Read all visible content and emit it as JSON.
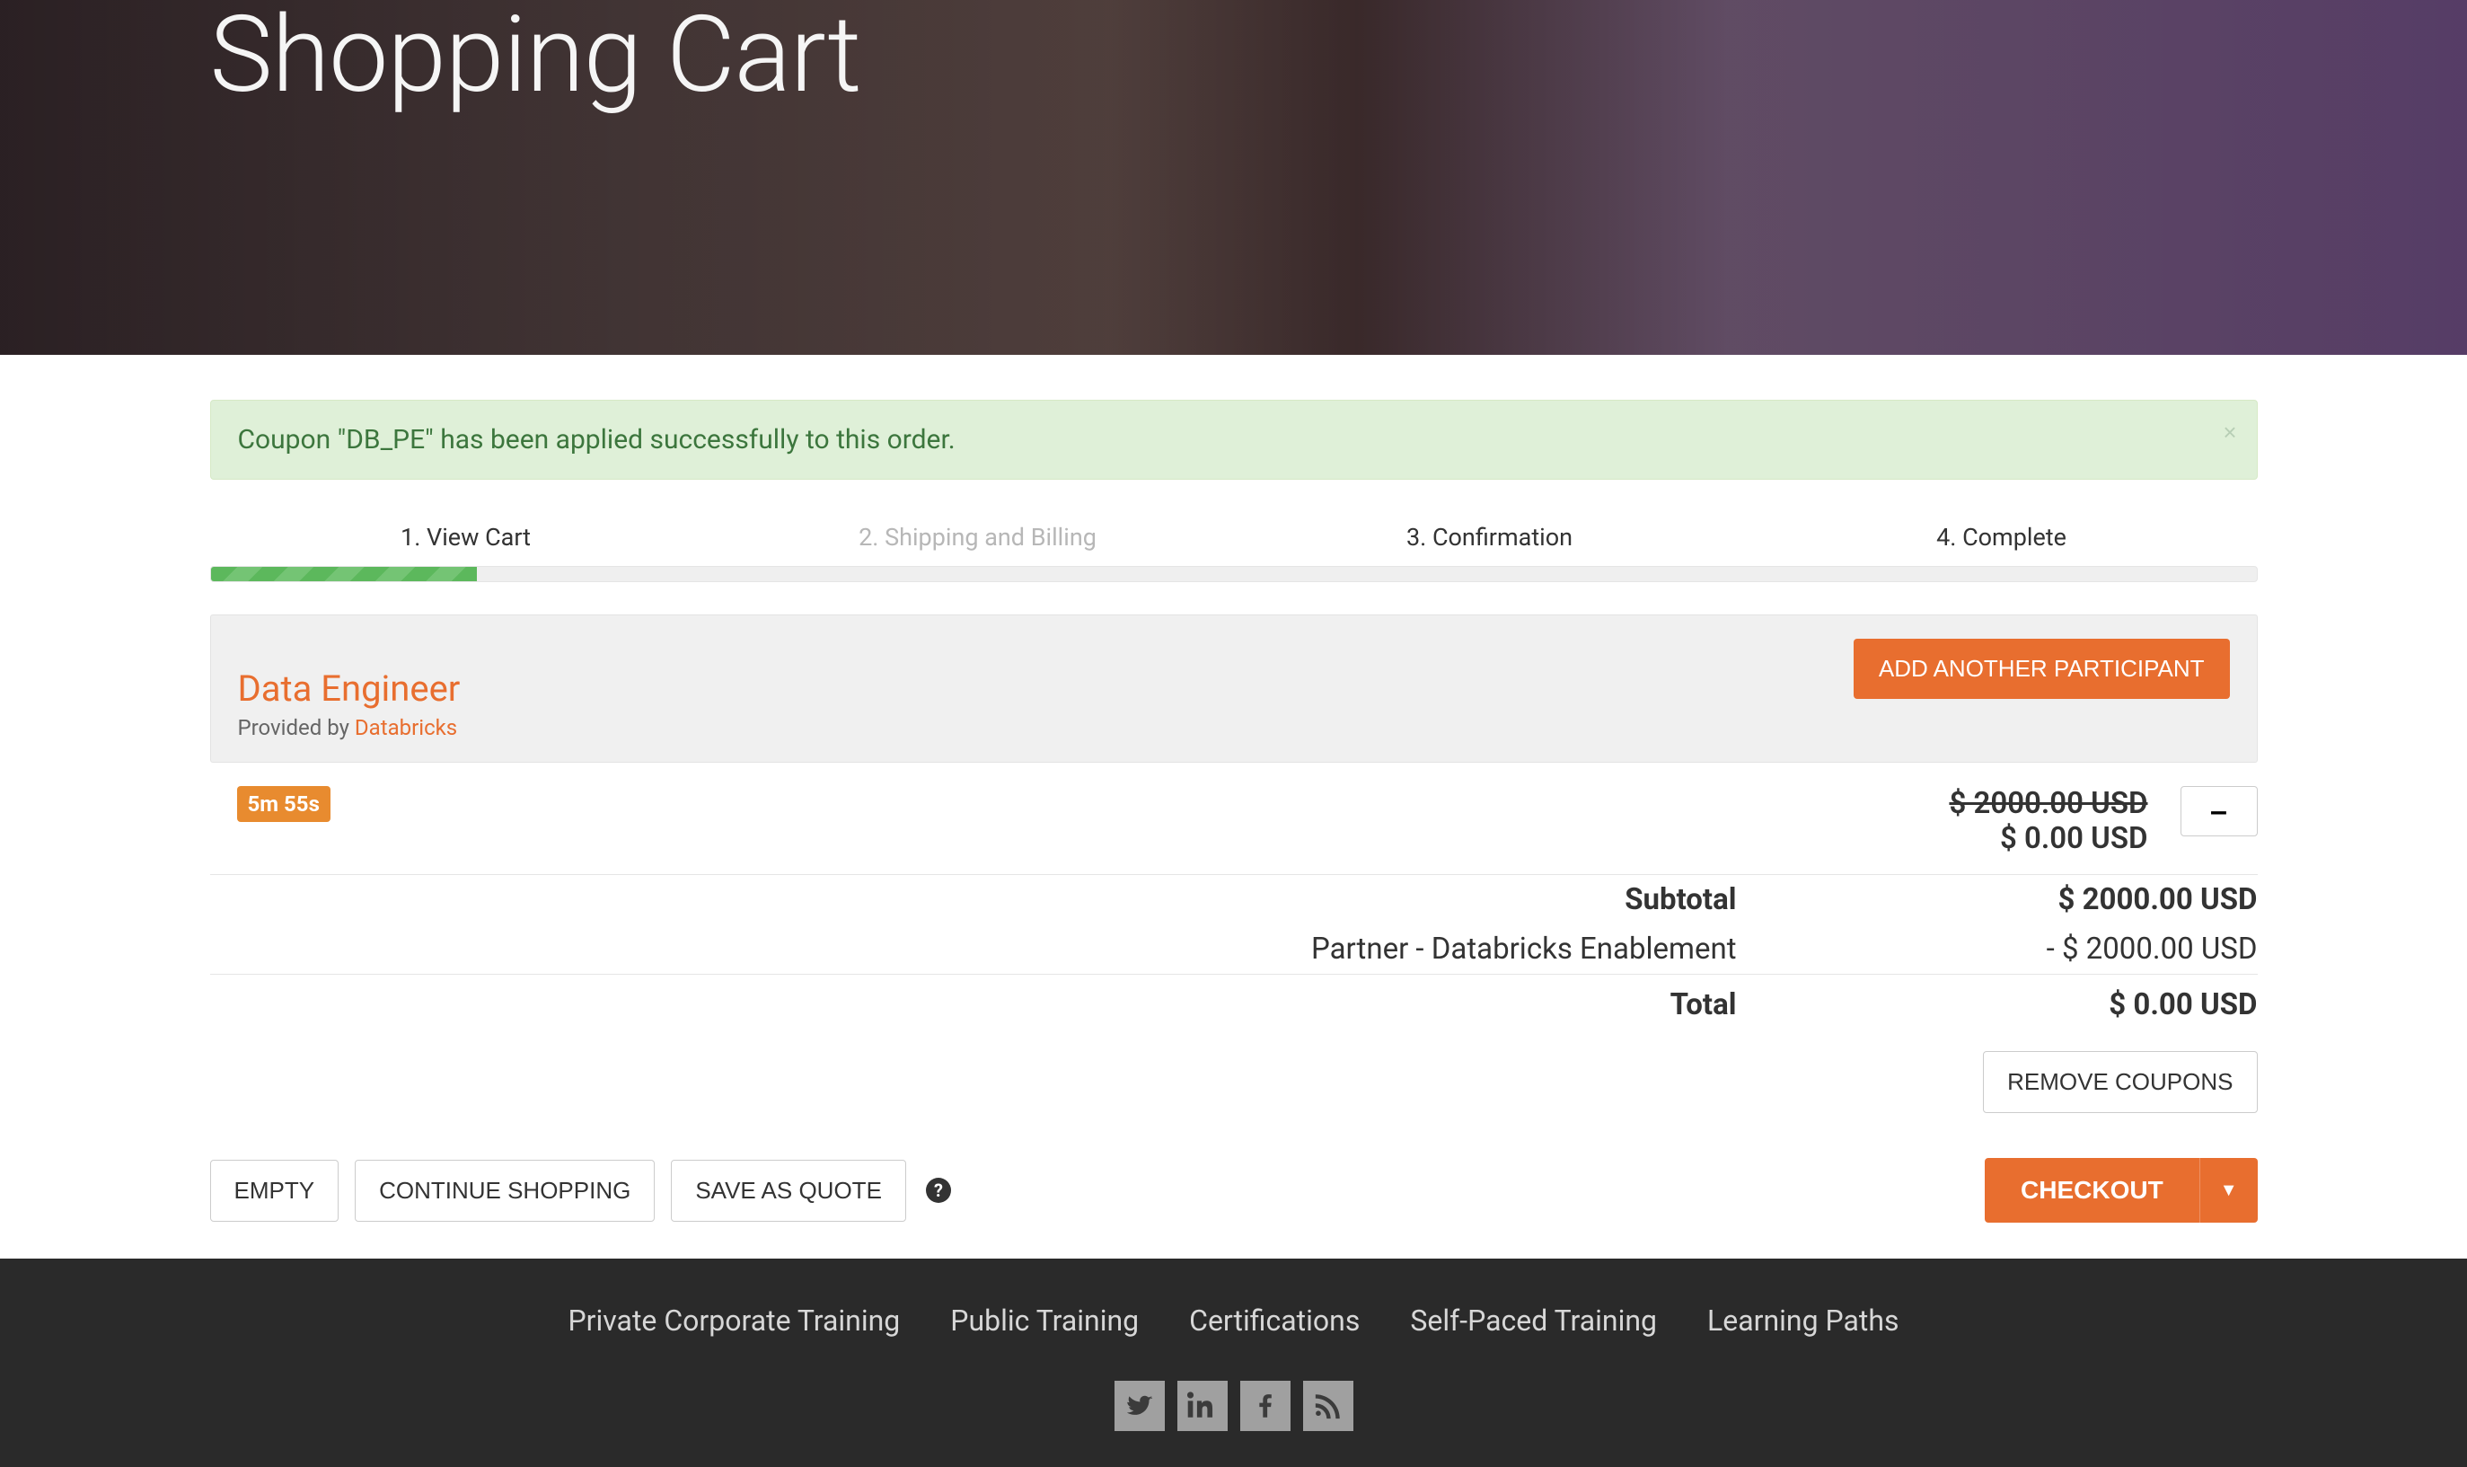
{
  "hero": {
    "title": "Shopping Cart"
  },
  "alert": {
    "message": "Coupon \"DB_PE\" has been applied successfully to this order."
  },
  "steps": {
    "s1": "1. View Cart",
    "s2": "2. Shipping and Billing",
    "s3": "3. Confirmation",
    "s4": "4. Complete"
  },
  "item": {
    "title": "Data Engineer",
    "provided_prefix": "Provided by ",
    "provider": "Databricks",
    "add_participant_label": "ADD ANOTHER PARTICIPANT",
    "timer": "5m 55s",
    "original_price": "$ 2000.00 USD",
    "current_price": "$ 0.00 USD",
    "remove_label": "–"
  },
  "totals": {
    "subtotal_label": "Subtotal",
    "subtotal_value": "$ 2000.00 USD",
    "discount_label": "Partner - Databricks Enablement",
    "discount_value": "- $ 2000.00 USD",
    "total_label": "Total",
    "total_value": "$ 0.00 USD",
    "remove_coupons_label": "REMOVE COUPONS"
  },
  "actions": {
    "empty": "EMPTY",
    "continue": "CONTINUE SHOPPING",
    "save_quote": "SAVE AS QUOTE",
    "checkout": "CHECKOUT"
  },
  "footer": {
    "links": {
      "private": "Private Corporate Training",
      "public": "Public Training",
      "certs": "Certifications",
      "selfpaced": "Self-Paced Training",
      "paths": "Learning Paths"
    }
  }
}
